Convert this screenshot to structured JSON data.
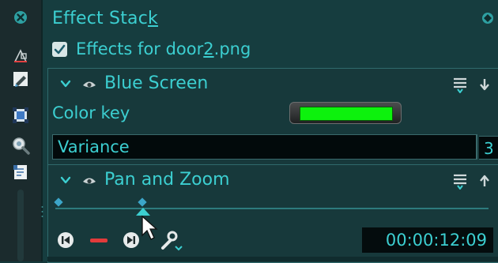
{
  "panel": {
    "title_pre": "Effect Stac",
    "title_ul": "k",
    "checkbox_checked": true,
    "checkbox_label_pre": "Effects for door",
    "checkbox_label_ul": "2",
    "checkbox_label_post": ".png"
  },
  "effects": [
    {
      "name": "Blue Screen",
      "params": {
        "color_key_label": "Color key",
        "color_key_value": "#0df20d",
        "variance_label": "Variance",
        "variance_value": "3"
      }
    },
    {
      "name": "Pan and Zoom",
      "timecode": "00:00:12:09",
      "keyframes": 2
    }
  ],
  "colors": {
    "accent": "#3ccfd1",
    "panel_bg": "#163d3f",
    "toolbar_bg": "#1b2b2d",
    "stop_button": "#e23b3b",
    "color_key": "#0df20d"
  },
  "icons": {
    "toolbar": [
      "close-icon",
      "crop-icon",
      "pen-tool-icon",
      "select-icon",
      "zoom-icon",
      "notes-icon"
    ],
    "panel_close": "close-icon",
    "header_icons": [
      "chevron-down-icon",
      "eye-icon",
      "menu-icon",
      "arrow-down-icon",
      "arrow-up-icon"
    ],
    "controls": [
      "previous-keyframe-icon",
      "stop-icon",
      "next-keyframe-icon",
      "wrench-icon"
    ]
  }
}
